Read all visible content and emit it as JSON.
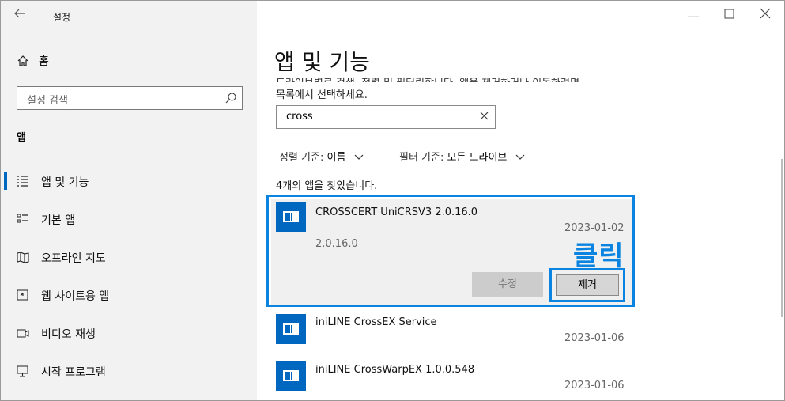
{
  "window": {
    "title": "설정"
  },
  "sidebar": {
    "home_label": "홈",
    "search_placeholder": "설정 검색",
    "section_label": "앱",
    "items": [
      {
        "label": "앱 및 기능",
        "icon": "apps-features-icon",
        "active": true
      },
      {
        "label": "기본 앱",
        "icon": "default-apps-icon",
        "active": false
      },
      {
        "label": "오프라인 지도",
        "icon": "offline-maps-icon",
        "active": false
      },
      {
        "label": "웹 사이트용 앱",
        "icon": "apps-for-websites-icon",
        "active": false
      },
      {
        "label": "비디오 재생",
        "icon": "video-playback-icon",
        "active": false
      },
      {
        "label": "시작 프로그램",
        "icon": "startup-icon",
        "active": false
      }
    ]
  },
  "main": {
    "title": "앱 및 기능",
    "desc_partial": "드라이브별로 검색, 정렬 및 필터링합니다. 앱을 제거하거나 이동하려면",
    "desc_line2": "목록에서 선택하세요.",
    "filter_value": "cross",
    "sort_label": "정렬 기준:",
    "sort_value": "이름",
    "filter_label": "필터 기준:",
    "filter_drive": "모든 드라이브",
    "found_text": "4개의 앱을 찾았습니다.",
    "apps": [
      {
        "name": "CROSSCERT UniCRSV3 2.0.16.0",
        "date": "2023-01-02",
        "version": "2.0.16.0"
      },
      {
        "name": "iniLINE CrossEX Service",
        "date": "2023-01-06"
      },
      {
        "name": "iniLINE CrossWarpEX 1.0.0.548",
        "date": "2023-01-06"
      }
    ],
    "modify_label": "수정",
    "remove_label": "제거",
    "annotation": "클릭"
  },
  "colors": {
    "accent": "#0067c0",
    "highlight": "#0a84e0"
  }
}
